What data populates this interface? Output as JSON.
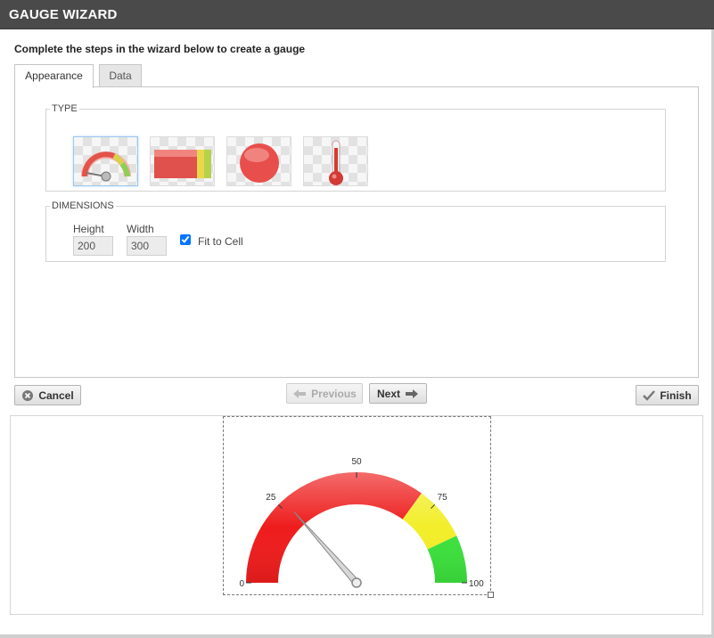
{
  "window": {
    "title": "GAUGE WIZARD"
  },
  "instruction": "Complete the steps in the wizard below to create a gauge",
  "tabs": [
    {
      "label": "Appearance",
      "active": true
    },
    {
      "label": "Data",
      "active": false
    }
  ],
  "type_group": {
    "legend": "TYPE",
    "options": [
      {
        "name": "radial-gauge",
        "selected": true
      },
      {
        "name": "linear-bar-gauge",
        "selected": false
      },
      {
        "name": "circle-gauge",
        "selected": false
      },
      {
        "name": "thermometer-gauge",
        "selected": false
      }
    ]
  },
  "dimensions": {
    "legend": "DIMENSIONS",
    "height_label": "Height",
    "height_value": "200",
    "width_label": "Width",
    "width_value": "300",
    "fit_to_cell_label": "Fit to Cell",
    "fit_to_cell_checked": true
  },
  "buttons": {
    "cancel": "Cancel",
    "previous": "Previous",
    "next": "Next",
    "finish": "Finish"
  },
  "preview_gauge": {
    "min": 0,
    "max": 100,
    "value": 27,
    "ticks": [
      {
        "value": 0,
        "label": "0"
      },
      {
        "value": 25,
        "label": "25"
      },
      {
        "value": 50,
        "label": "50"
      },
      {
        "value": 75,
        "label": "75"
      },
      {
        "value": 100,
        "label": "100"
      }
    ],
    "bands": [
      {
        "from": 0,
        "to": 70,
        "color": "#ee1c1c"
      },
      {
        "from": 70,
        "to": 86,
        "color": "#f2ee2a"
      },
      {
        "from": 86,
        "to": 100,
        "color": "#3ce03c"
      }
    ]
  },
  "colors": {
    "titlebar": "#4a4a4a",
    "band_red": "#ee1c1c",
    "band_yellow": "#f2ee2a",
    "band_green": "#3ce03c"
  }
}
